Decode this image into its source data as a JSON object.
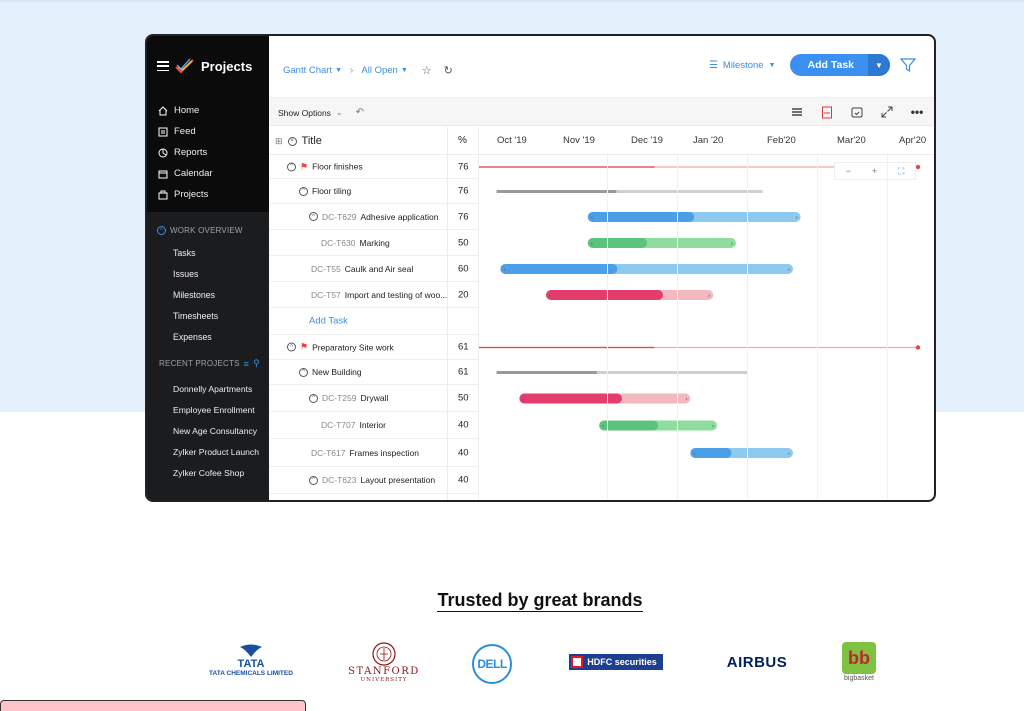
{
  "sidebar": {
    "brand": "Projects",
    "nav": [
      {
        "label": "Home",
        "icon": "home-icon"
      },
      {
        "label": "Feed",
        "icon": "feed-icon"
      },
      {
        "label": "Reports",
        "icon": "reports-icon"
      },
      {
        "label": "Calendar",
        "icon": "calendar-icon"
      },
      {
        "label": "Projects",
        "icon": "projects-icon"
      }
    ],
    "work_overview": {
      "heading": "WORK OVERVIEW",
      "items": [
        "Tasks",
        "Issues",
        "Milestones",
        "Timesheets",
        "Expenses"
      ]
    },
    "recent_projects": {
      "heading": "RECENT PROJECTS",
      "items": [
        "Donnelly Apartments",
        "Employee Enrollment",
        "New Age Consultancy",
        "Zylker Product Launch",
        "Zylker Cofee Shop"
      ]
    }
  },
  "topbar": {
    "view": "Gantt Chart",
    "filter": "All Open",
    "milestone": "Milestone",
    "add_task": "Add Task"
  },
  "options": {
    "show_options": "Show Options"
  },
  "grid": {
    "title_col": "Title",
    "pct_col": "%",
    "months": [
      "Oct '19",
      "Nov '19",
      "Dec '19",
      "Jan '20",
      "Feb'20",
      "Mar'20",
      "Apr'20"
    ],
    "rows": [
      {
        "code": "",
        "name": "Floor finishes",
        "pct": "76",
        "type": "milestone"
      },
      {
        "code": "",
        "name": "Floor tiling",
        "pct": "76",
        "type": "group"
      },
      {
        "code": "DC-T629",
        "name": "Adhesive application",
        "pct": "76",
        "type": "task"
      },
      {
        "code": "DC-T630",
        "name": "Marking",
        "pct": "50",
        "type": "task"
      },
      {
        "code": "DC-T55",
        "name": "Caulk and Air seal",
        "pct": "60",
        "type": "task"
      },
      {
        "code": "DC-T57",
        "name": "Import and testing of woo...",
        "pct": "20",
        "type": "task"
      },
      {
        "code": "",
        "name": "Add Task",
        "pct": "",
        "type": "add"
      },
      {
        "code": "",
        "name": "Preparatory Site work",
        "pct": "61",
        "type": "milestone"
      },
      {
        "code": "",
        "name": "New Building",
        "pct": "61",
        "type": "group"
      },
      {
        "code": "DC-T259",
        "name": "Drywall",
        "pct": "50",
        "type": "task"
      },
      {
        "code": "DC-T707",
        "name": "Interior",
        "pct": "40",
        "type": "task"
      },
      {
        "code": "DC-T617",
        "name": "Frames inspection",
        "pct": "40",
        "type": "task"
      },
      {
        "code": "DC-T623",
        "name": "Layout presentation",
        "pct": "40",
        "type": "task"
      }
    ],
    "bars": [
      {
        "row": 0,
        "kind": "milestone",
        "start": 0.0,
        "end": 1.0,
        "progress": 0.4
      },
      {
        "row": 1,
        "kind": "summary",
        "start": 0.02,
        "end": 0.72,
        "progress": 0.45
      },
      {
        "row": 2,
        "kind": "task",
        "color": "#4a9fe8",
        "light": "#8ccaf1",
        "start": 0.26,
        "end": 0.82,
        "progress": 0.5
      },
      {
        "row": 3,
        "kind": "task",
        "color": "#5cc37a",
        "light": "#8fdc9f",
        "start": 0.26,
        "end": 0.65,
        "progress": 0.4
      },
      {
        "row": 4,
        "kind": "task",
        "color": "#4a9fe8",
        "light": "#8ccaf1",
        "start": 0.03,
        "end": 0.8,
        "progress": 0.4
      },
      {
        "row": 5,
        "kind": "task",
        "color": "#e23d6d",
        "light": "#f3b8c0",
        "start": 0.15,
        "end": 0.59,
        "progress": 0.7
      },
      {
        "row": 7,
        "kind": "milestone",
        "start": 0.0,
        "end": 1.0,
        "progress": 0.4
      },
      {
        "row": 8,
        "kind": "summary",
        "start": 0.02,
        "end": 0.68,
        "progress": 0.4
      },
      {
        "row": 9,
        "kind": "task",
        "color": "#e23d6d",
        "light": "#f3b8c0",
        "start": 0.08,
        "end": 0.53,
        "progress": 0.6
      },
      {
        "row": 10,
        "kind": "task",
        "color": "#5cc37a",
        "light": "#8fdc9f",
        "start": 0.29,
        "end": 0.6,
        "progress": 0.5
      },
      {
        "row": 11,
        "kind": "task",
        "color": "#4a9fe8",
        "light": "#8ccaf1",
        "start": 0.53,
        "end": 0.8,
        "progress": 0.4
      }
    ]
  },
  "lower": {
    "trusted": "Trusted by great brands",
    "brands": {
      "tata_main": "TATA",
      "tata_sub": "TATA CHEMICALS LIMITED",
      "stanford_main": "STANFORD",
      "stanford_sub": "UNIVERSITY",
      "dell": "DELL",
      "hdfc": "HDFC securities",
      "airbus": "AIRBUS",
      "bigbasket_mark": "bb",
      "bigbasket": "bigbasket"
    }
  }
}
